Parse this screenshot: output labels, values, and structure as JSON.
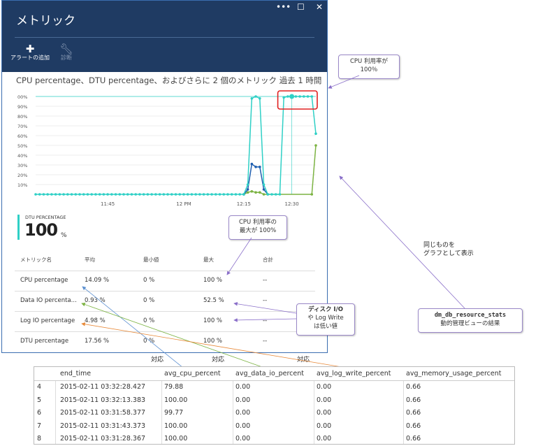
{
  "window": {
    "title": "メトリック",
    "controls": [
      "•••",
      "☐",
      "✕"
    ]
  },
  "toolbar": {
    "add_alert": "アラートの追加",
    "diagnostics": "診断"
  },
  "chart_title": "CPU percentage、DTU percentage、およびさらに 2 個のメトリック 過去 1 時間",
  "chart_data": {
    "type": "line",
    "ylim": [
      0,
      100
    ],
    "y_ticks": [
      "00%",
      "90%",
      "80%",
      "70%",
      "60%",
      "50%",
      "40%",
      "30%",
      "20%",
      "10%"
    ],
    "x_ticks": [
      "11:45",
      "12 PM",
      "12:15",
      "12:30"
    ],
    "series": [
      {
        "name": "CPU percentage",
        "color": "#2fd0c6",
        "values": [
          [
            0,
            0
          ],
          [
            1,
            0
          ],
          [
            2,
            0
          ],
          [
            3,
            0
          ],
          [
            4,
            0
          ],
          [
            5,
            0
          ],
          [
            6,
            0
          ],
          [
            7,
            0
          ],
          [
            8,
            0
          ],
          [
            9,
            0
          ],
          [
            10,
            0
          ],
          [
            11,
            0
          ],
          [
            12,
            0
          ],
          [
            13,
            0
          ],
          [
            14,
            0
          ],
          [
            15,
            0
          ],
          [
            16,
            0
          ],
          [
            17,
            0
          ],
          [
            18,
            0
          ],
          [
            19,
            0
          ],
          [
            20,
            0
          ],
          [
            21,
            0
          ],
          [
            22,
            0
          ],
          [
            23,
            0
          ],
          [
            24,
            0
          ],
          [
            25,
            0
          ],
          [
            26,
            0
          ],
          [
            27,
            0
          ],
          [
            28,
            0
          ],
          [
            29,
            0
          ],
          [
            30,
            0
          ],
          [
            31,
            0
          ],
          [
            32,
            0
          ],
          [
            33,
            0
          ],
          [
            34,
            0
          ],
          [
            35,
            0
          ],
          [
            36,
            0
          ],
          [
            37,
            0
          ],
          [
            38,
            0
          ],
          [
            39,
            0
          ],
          [
            40,
            0
          ],
          [
            41,
            0
          ],
          [
            42,
            0
          ],
          [
            43,
            0
          ],
          [
            44,
            0
          ],
          [
            45,
            0
          ],
          [
            46,
            0
          ],
          [
            47,
            0
          ],
          [
            48,
            0
          ],
          [
            49,
            0
          ],
          [
            50,
            0
          ],
          [
            51,
            0
          ],
          [
            52,
            0
          ],
          [
            53,
            10
          ],
          [
            54,
            98
          ],
          [
            55,
            100
          ],
          [
            56,
            98
          ],
          [
            57,
            10
          ],
          [
            58,
            0
          ],
          [
            59,
            0
          ],
          [
            60,
            0
          ],
          [
            61,
            0
          ],
          [
            62,
            99
          ],
          [
            63,
            100
          ],
          [
            64,
            100
          ],
          [
            65,
            100
          ],
          [
            66,
            100
          ],
          [
            67,
            100
          ],
          [
            68,
            100
          ],
          [
            69,
            100
          ],
          [
            70,
            62
          ]
        ]
      },
      {
        "name": "Data IO percentage",
        "color": "#1f5fb0",
        "values": [
          [
            52,
            0
          ],
          [
            53,
            5
          ],
          [
            54,
            31
          ],
          [
            55,
            28
          ],
          [
            56,
            28
          ],
          [
            57,
            5
          ],
          [
            58,
            0
          ]
        ]
      },
      {
        "name": "Log IO percentage",
        "color": "#7cb342",
        "values": [
          [
            52,
            0
          ],
          [
            53,
            2
          ],
          [
            54,
            3
          ],
          [
            55,
            2
          ],
          [
            56,
            2
          ],
          [
            57,
            0
          ],
          [
            69,
            0
          ],
          [
            70,
            50
          ]
        ]
      }
    ]
  },
  "dtu": {
    "label": "DTU PERCENTAGE",
    "value": "100",
    "unit": "%"
  },
  "metrics_table": {
    "headers": [
      "メトリック名",
      "平均",
      "最小値",
      "最大",
      "合計"
    ],
    "rows": [
      [
        "CPU percentage",
        "14.09 %",
        "0 %",
        "100 %",
        "--"
      ],
      [
        "Data IO percenta...",
        "0.93 %",
        "0 %",
        "52.5 %",
        "--"
      ],
      [
        "Log IO percentage",
        "4.98 %",
        "0 %",
        "100 %",
        "--"
      ],
      [
        "DTU percentage",
        "17.56 %",
        "0 %",
        "100 %",
        "--"
      ]
    ]
  },
  "callouts": {
    "cpu_100_line1": "CPU 利用率が",
    "cpu_100_line2": "100％",
    "cpu_max_line1": "CPU 利用率の",
    "cpu_max_line2": "最大が 100%",
    "io_line1": "ディスク I/O",
    "io_line2": "や Log Write",
    "io_line3": "は低い値",
    "dmv_line1": "dm_db_resource_stats",
    "dmv_line2": "動的管理ビューの結果"
  },
  "notes": {
    "same_line1": "同じものを",
    "same_line2": "グラフとして表示",
    "taiou1": "対応",
    "taiou2": "対応",
    "taiou3": "対応"
  },
  "result_grid": {
    "headers": [
      "end_time",
      "avg_cpu_percent",
      "avg_data_io_percent",
      "avg_log_write_percent",
      "avg_memory_usage_percent"
    ],
    "rows": [
      [
        "4",
        "2015-02-11 03:32:28.427",
        "79.88",
        "0.00",
        "0.00",
        "0.66"
      ],
      [
        "5",
        "2015-02-11 03:32:13.383",
        "100.00",
        "0.00",
        "0.00",
        "0.66"
      ],
      [
        "6",
        "2015-02-11 03:31:58.377",
        "99.77",
        "0.00",
        "0.00",
        "0.66"
      ],
      [
        "7",
        "2015-02-11 03:31:43.373",
        "100.00",
        "0.00",
        "0.00",
        "0.66"
      ],
      [
        "8",
        "2015-02-11 03:31:28.367",
        "100.00",
        "0.00",
        "0.00",
        "0.66"
      ]
    ]
  }
}
